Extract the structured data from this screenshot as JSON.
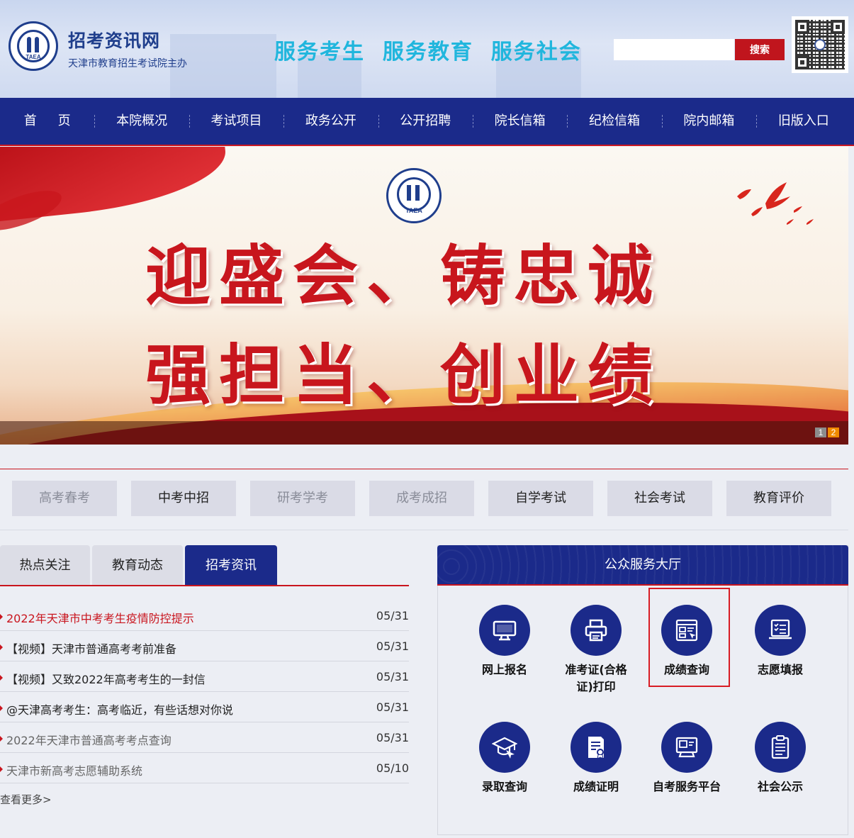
{
  "header": {
    "site_name": "招考资讯网",
    "site_sub": "天津市教育招生考试院主办",
    "logo_text": "TAEA",
    "slogan": "服务考生  服务教育  服务社会",
    "search": {
      "placeholder": "",
      "button": "搜索"
    }
  },
  "nav": {
    "items": [
      "首页",
      "本院概况",
      "考试项目",
      "政务公开",
      "公开招聘",
      "院长信箱",
      "纪检信箱",
      "院内邮箱",
      "旧版入口"
    ]
  },
  "banner": {
    "logo_text": "TAEA",
    "line1": "迎盛会、铸忠诚",
    "line2": "强担当、创业绩",
    "pages": [
      "1",
      "2"
    ],
    "active_page": 2
  },
  "categories": [
    {
      "label": "高考春考",
      "dim": true
    },
    {
      "label": "中考中招",
      "dim": false
    },
    {
      "label": "研考学考",
      "dim": true
    },
    {
      "label": "成考成招",
      "dim": true
    },
    {
      "label": "自学考试",
      "dim": false
    },
    {
      "label": "社会考试",
      "dim": false
    },
    {
      "label": "教育评价",
      "dim": false
    }
  ],
  "news": {
    "tabs": [
      "热点关注",
      "教育动态",
      "招考资讯"
    ],
    "active_tab": 2,
    "items": [
      {
        "title": "2022年天津市中考考生疫情防控提示",
        "date": "05/31",
        "style": "red"
      },
      {
        "title": "【视频】天津市普通高考考前准备",
        "date": "05/31",
        "style": "normal"
      },
      {
        "title": "【视频】又致2022年高考考生的一封信",
        "date": "05/31",
        "style": "normal"
      },
      {
        "title": "@天津高考考生：高考临近，有些话想对你说",
        "date": "05/31",
        "style": "normal"
      },
      {
        "title": "2022年天津市普通高考考点查询",
        "date": "05/31",
        "style": "grey"
      },
      {
        "title": "天津市新高考志愿辅助系统",
        "date": "05/10",
        "style": "grey"
      }
    ],
    "more": "查看更多>"
  },
  "hall": {
    "title": "公众服务大厅",
    "services": [
      {
        "label": "网上报名",
        "icon": "monitor-icon"
      },
      {
        "label": "准考证(合格证)打印",
        "icon": "printer-icon"
      },
      {
        "label": "成绩查询",
        "icon": "score-search-icon"
      },
      {
        "label": "志愿填报",
        "icon": "checklist-laptop-icon"
      },
      {
        "label": "录取查询",
        "icon": "graduation-cap-icon"
      },
      {
        "label": "成绩证明",
        "icon": "certificate-icon"
      },
      {
        "label": "自考服务平台",
        "icon": "self-study-platform-icon"
      },
      {
        "label": "社会公示",
        "icon": "clipboard-icon"
      }
    ],
    "highlighted": "成绩查询"
  },
  "colors": {
    "nav_blue": "#1b2a8a",
    "accent_red": "#c9151e",
    "slogan_cyan": "#21b6dd",
    "pager_active": "#f08a00"
  }
}
